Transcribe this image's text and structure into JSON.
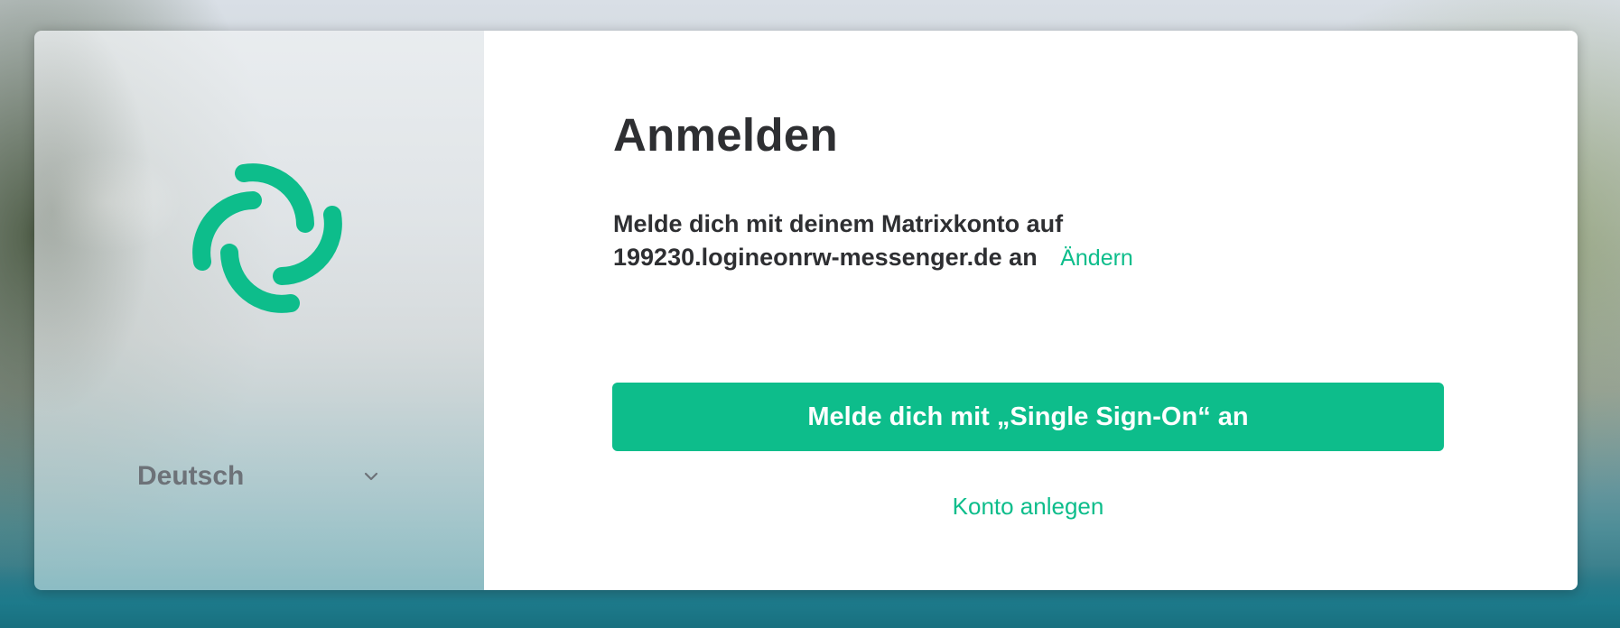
{
  "brand": {
    "logo_icon": "element-logo-icon",
    "accent_color": "#0dbd8b"
  },
  "language": {
    "selected": "Deutsch",
    "icon": "chevron-down-icon"
  },
  "login": {
    "title": "Anmelden",
    "server_text_line1": "Melde dich mit deinem Matrixkonto auf",
    "server_text_line2": "199230.logineonrw-messenger.de an",
    "change_label": "Ändern",
    "sso_button_label": "Melde dich mit „Single Sign-On“ an",
    "register_label": "Konto anlegen"
  }
}
